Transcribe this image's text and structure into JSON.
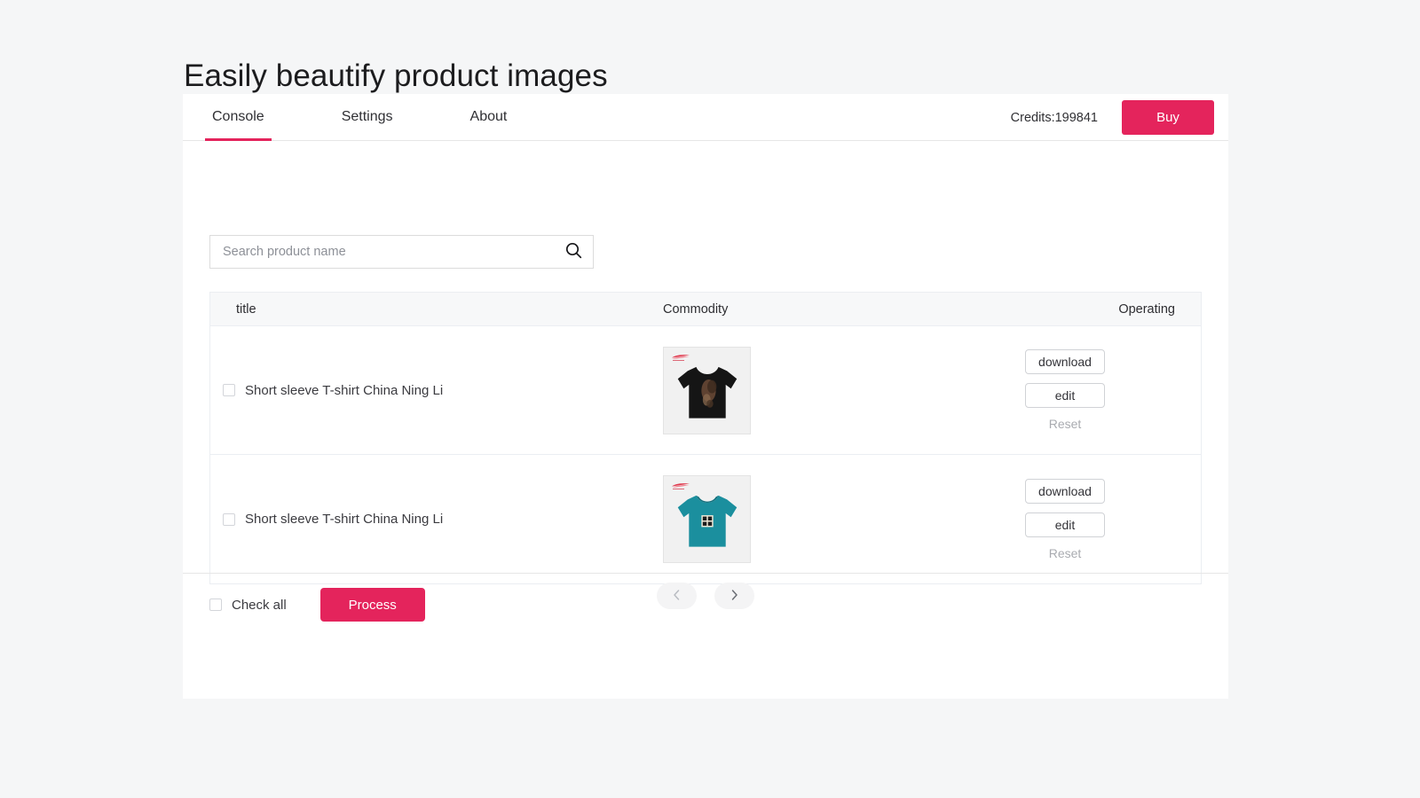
{
  "page": {
    "title": "Easily beautify product images",
    "background_color": "#f5f6f7",
    "accent_color": "#e4245c"
  },
  "nav": {
    "tabs": [
      {
        "label": "Console",
        "active": true
      },
      {
        "label": "Settings",
        "active": false
      },
      {
        "label": "About",
        "active": false
      }
    ],
    "credits_label": "Credits:199841",
    "buy_label": "Buy"
  },
  "search": {
    "placeholder": "Search product name",
    "value": "",
    "icon": "search-icon"
  },
  "table": {
    "headers": {
      "title": "title",
      "commodity": "Commodity",
      "operating": "Operating"
    },
    "rows": [
      {
        "checked": false,
        "title": "Short sleeve T-shirt China Ning Li",
        "thumbnail": {
          "shirt_color": "#151515",
          "background": "#f1f1f1",
          "logo_color": "#e03a4e",
          "graphic": "print-graphic"
        },
        "actions": {
          "download": "download",
          "edit": "edit",
          "reset": "Reset"
        }
      },
      {
        "checked": false,
        "title": "Short sleeve T-shirt China Ning Li",
        "thumbnail": {
          "shirt_color": "#1b8f9e",
          "background": "#f1f1f1",
          "logo_color": "#e03a4e",
          "graphic": "square-print-graphic"
        },
        "actions": {
          "download": "download",
          "edit": "edit",
          "reset": "Reset"
        }
      }
    ]
  },
  "pagination": {
    "prev_icon": "chevron-left-icon",
    "next_icon": "chevron-right-icon"
  },
  "footer": {
    "check_all_label": "Check all",
    "check_all_checked": false,
    "process_label": "Process"
  }
}
